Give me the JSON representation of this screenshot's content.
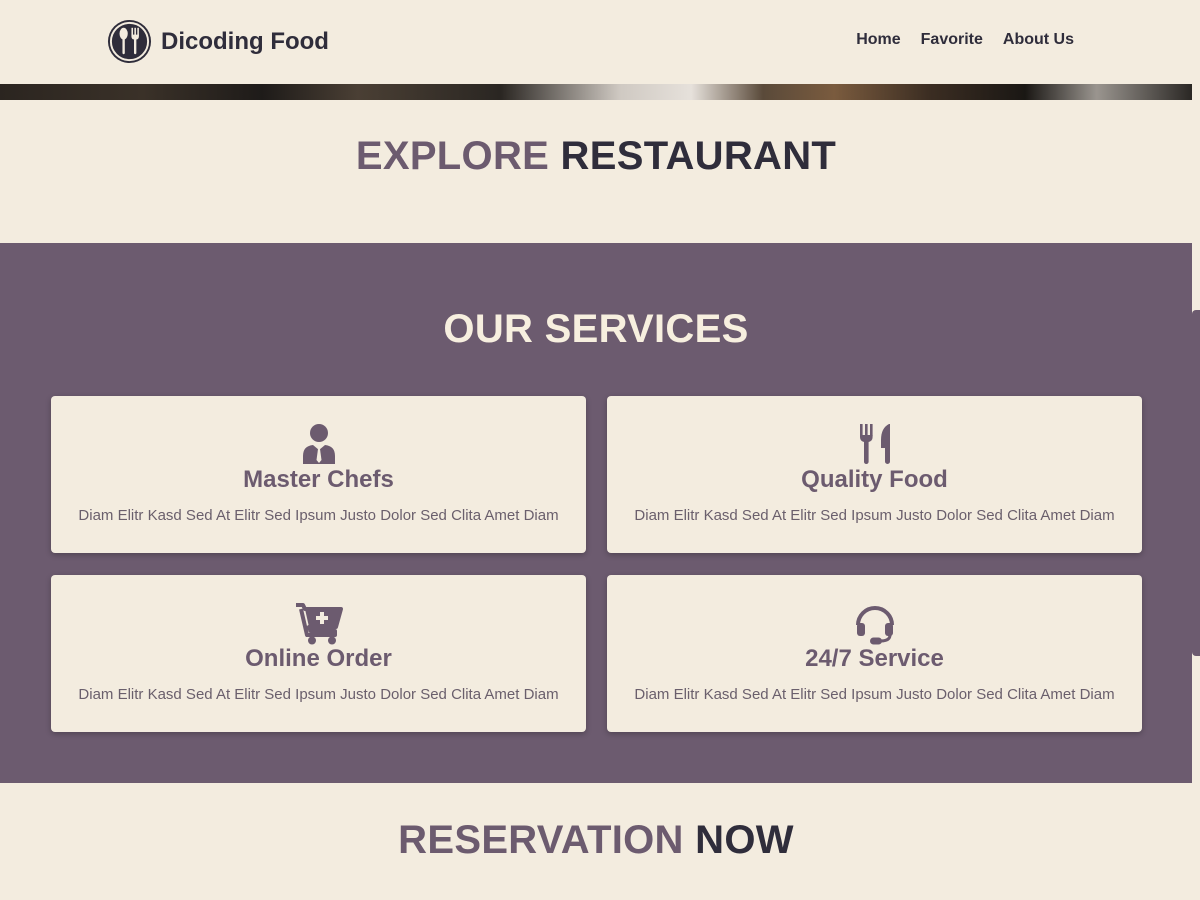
{
  "header": {
    "brand": "Dicoding Food",
    "brand_logo_icon": "spoon-fork-logo-icon",
    "nav": [
      {
        "label": "Home"
      },
      {
        "label": "Favorite"
      },
      {
        "label": "About Us"
      }
    ]
  },
  "explore": {
    "title_accent": "EXPLORE",
    "title_main": "RESTAURANT"
  },
  "services": {
    "title": "OUR SERVICES",
    "cards": [
      {
        "icon": "chef-person-icon",
        "title": "Master Chefs",
        "desc": "Diam Elitr Kasd Sed At Elitr Sed Ipsum Justo Dolor Sed Clita Amet Diam"
      },
      {
        "icon": "utensils-icon",
        "title": "Quality Food",
        "desc": "Diam Elitr Kasd Sed At Elitr Sed Ipsum Justo Dolor Sed Clita Amet Diam"
      },
      {
        "icon": "cart-plus-icon",
        "title": "Online Order",
        "desc": "Diam Elitr Kasd Sed At Elitr Sed Ipsum Justo Dolor Sed Clita Amet Diam"
      },
      {
        "icon": "headset-icon",
        "title": "24/7 Service",
        "desc": "Diam Elitr Kasd Sed At Elitr Sed Ipsum Justo Dolor Sed Clita Amet Diam"
      }
    ]
  },
  "reservation": {
    "title_accent": "RESERVATION",
    "title_main": "NOW"
  },
  "colors": {
    "background": "#f3ecdf",
    "accent": "#6c5b6f",
    "text_dark": "#2f2d3b",
    "services_title": "#f7efdf"
  }
}
